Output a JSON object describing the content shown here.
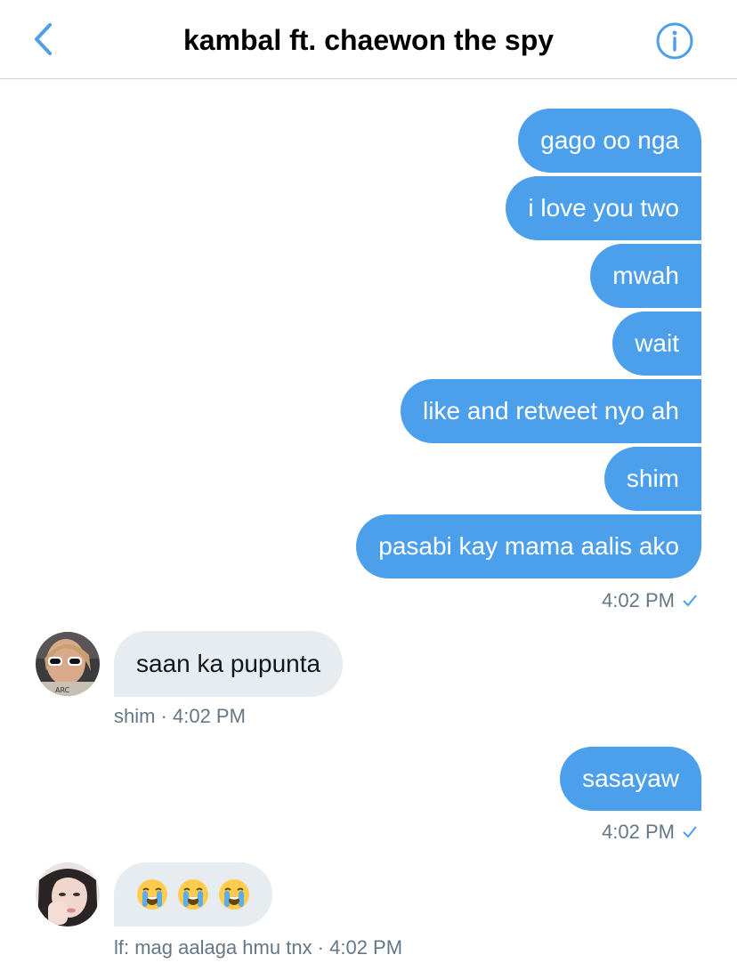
{
  "header": {
    "title": "kambal ft. chaewon the spy",
    "back_icon": "chevron-left-icon",
    "info_icon": "info-icon",
    "accent": "#4c9fea"
  },
  "messages": [
    {
      "side": "sent",
      "text": "gago oo nga"
    },
    {
      "side": "sent",
      "text": "i love you two"
    },
    {
      "side": "sent",
      "text": "mwah"
    },
    {
      "side": "sent",
      "text": "wait"
    },
    {
      "side": "sent",
      "text": "like and retweet nyo ah"
    },
    {
      "side": "sent",
      "text": "shim"
    },
    {
      "side": "sent",
      "text": "pasabi kay mama aalis ako"
    },
    {
      "side": "meta",
      "text": "4:02 PM"
    },
    {
      "side": "received",
      "text": "saan ka pupunta"
    },
    {
      "side": "meta",
      "text": "shim · 4:02 PM"
    },
    {
      "side": "sent",
      "text": "sasayaw"
    },
    {
      "side": "meta",
      "text": "4:02 PM"
    },
    {
      "side": "received",
      "text": "😭😭😭",
      "emoji": [
        "loudly-crying-face",
        "loudly-crying-face",
        "loudly-crying-face"
      ]
    },
    {
      "side": "meta",
      "text": "lf: mag aalaga hmu tnx · 4:02 PM"
    }
  ],
  "colors": {
    "sent_bubble": "#4c9fea",
    "received_bubble": "#e6ecf0",
    "meta_text": "#657786"
  }
}
